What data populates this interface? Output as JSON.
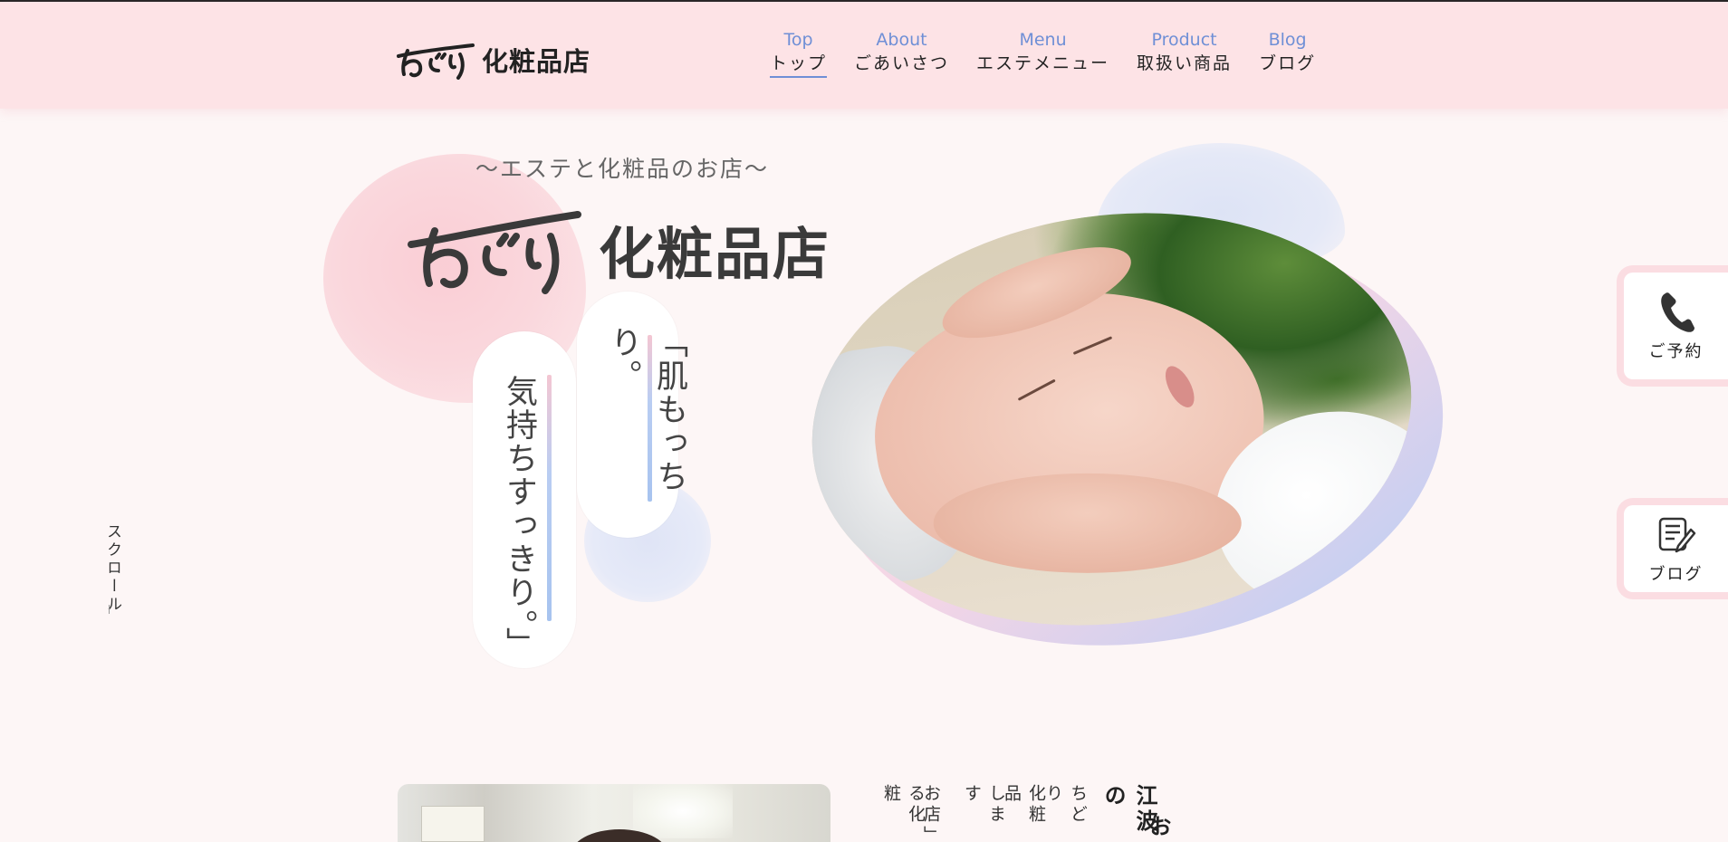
{
  "header": {
    "logo_script": "ちどり",
    "logo_text": "化粧品店",
    "nav": [
      {
        "en": "Top",
        "ja": "トップ",
        "active": true
      },
      {
        "en": "About",
        "ja": "ごあいさつ"
      },
      {
        "en": "Menu",
        "ja": "エステメニュー"
      },
      {
        "en": "Product",
        "ja": "取扱い商品"
      },
      {
        "en": "Blog",
        "ja": "ブログ"
      }
    ]
  },
  "hero": {
    "tagline": "〜エステと化粧品のお店〜",
    "logo_script": "ちどり",
    "logo_text": "化粧品店",
    "catch_1": "「肌もっちり。",
    "catch_2": "気持ちすっきり。」",
    "scroll_label": "スクロール"
  },
  "side": {
    "reserve_label": "ご予約",
    "blog_label": "ブログ"
  },
  "intro": {
    "heading": "江波の",
    "subheading": "お",
    "columns": [
      "ちどり",
      "化粧品",
      "します",
      "お店」",
      "る化粧"
    ]
  },
  "colors": {
    "header_bg": "#fde3e6",
    "nav_en": "#6f8fd6",
    "page_bg": "#fdf6f6",
    "side_border": "#fbdde2"
  }
}
